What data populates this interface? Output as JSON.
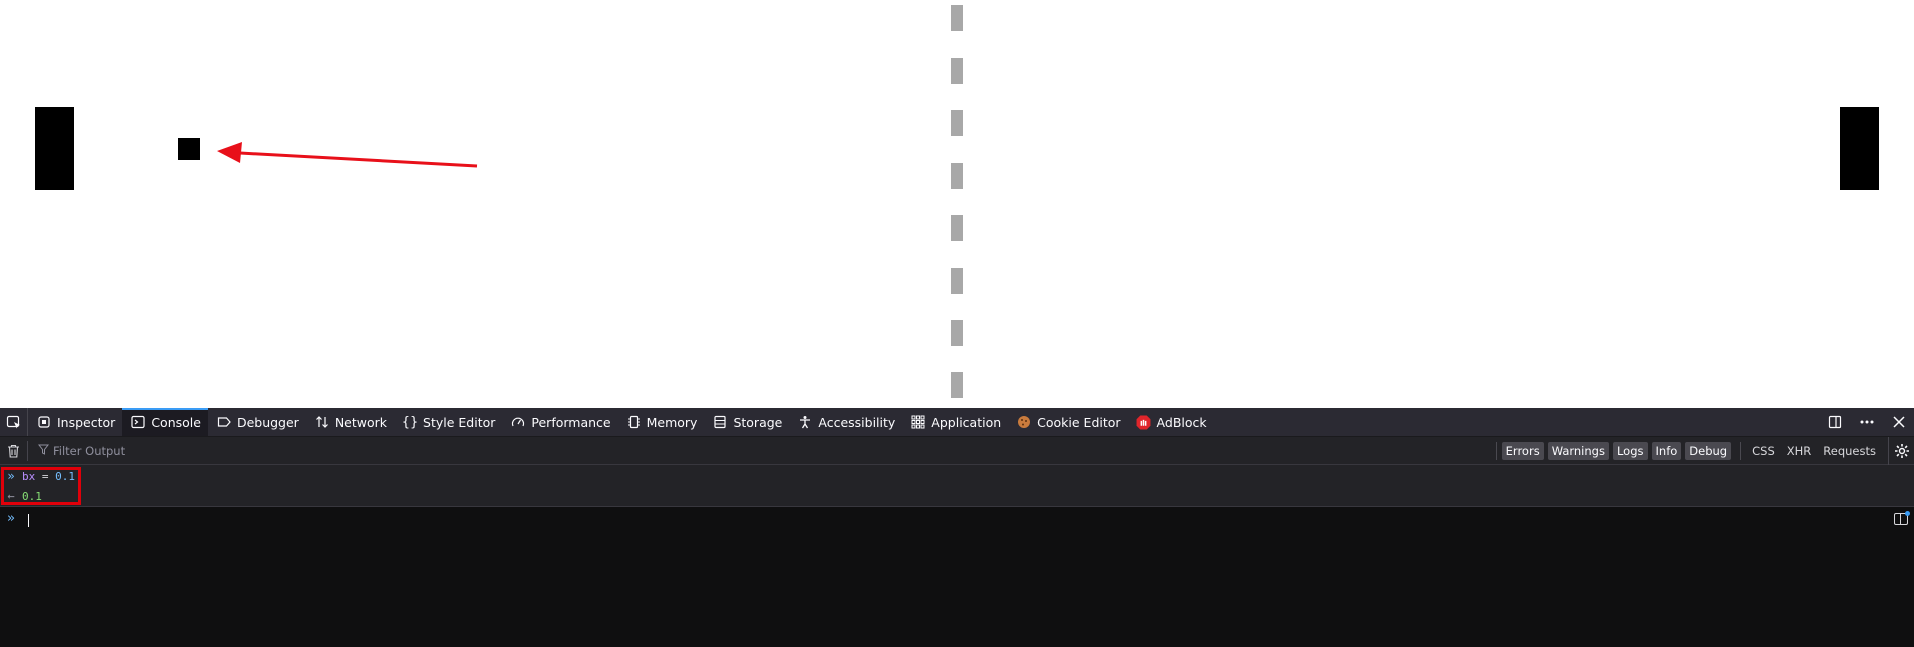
{
  "devtools": {
    "tabs": [
      {
        "label": "Inspector",
        "icon": "inspector-icon"
      },
      {
        "label": "Console",
        "icon": "console-icon",
        "selected": true
      },
      {
        "label": "Debugger",
        "icon": "debugger-icon"
      },
      {
        "label": "Network",
        "icon": "network-icon"
      },
      {
        "label": "Style Editor",
        "icon": "style-editor-icon"
      },
      {
        "label": "Performance",
        "icon": "performance-icon"
      },
      {
        "label": "Memory",
        "icon": "memory-icon"
      },
      {
        "label": "Storage",
        "icon": "storage-icon"
      },
      {
        "label": "Accessibility",
        "icon": "accessibility-icon"
      },
      {
        "label": "Application",
        "icon": "application-icon"
      },
      {
        "label": "Cookie Editor",
        "icon": "cookie-icon"
      },
      {
        "label": "AdBlock",
        "icon": "adblock-icon"
      }
    ],
    "filter": {
      "placeholder": "Filter Output",
      "chips": [
        "Errors",
        "Warnings",
        "Logs",
        "Info",
        "Debug"
      ],
      "extras": [
        "CSS",
        "XHR",
        "Requests"
      ]
    },
    "console": {
      "command": {
        "ident": "bx",
        "op": " = ",
        "value": "0.1"
      },
      "result": "0.1"
    }
  },
  "colors": {
    "accent": "#3a9cf5",
    "highlight": "#e0000a",
    "arrow": "#e8101a",
    "adblock": "#e0252b"
  }
}
